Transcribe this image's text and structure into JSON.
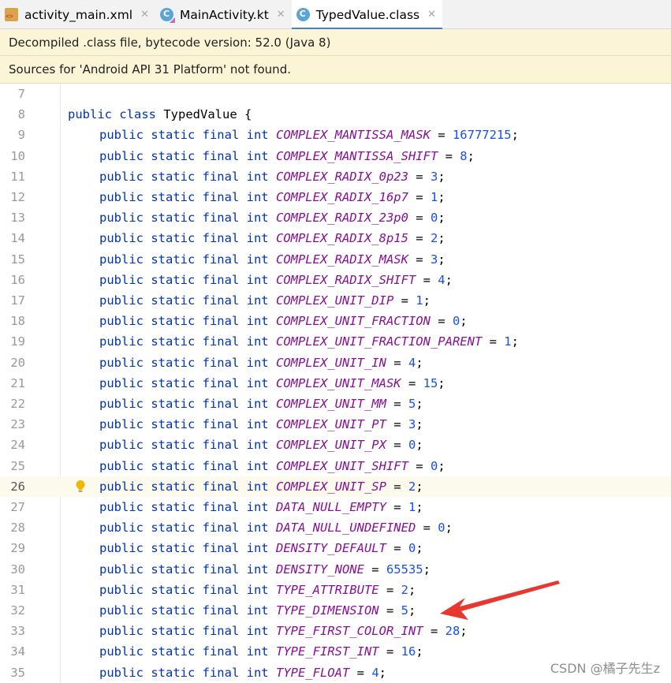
{
  "tabs": [
    {
      "label": "activity_main.xml",
      "icon": "xml-file-icon"
    },
    {
      "label": "MainActivity.kt",
      "icon": "kotlin-file-icon"
    },
    {
      "label": "TypedValue.class",
      "icon": "class-file-icon"
    }
  ],
  "banners": {
    "decompiled": "Decompiled .class file, bytecode version: 52.0 (Java 8)",
    "sources": "Sources for 'Android API 31 Platform' not found."
  },
  "code": {
    "class_line": {
      "num": "8",
      "keyword": "public class",
      "name": "TypedValue {"
    },
    "modifiers": "public static final int",
    "first_line_number": "7",
    "fields": [
      {
        "num": "9",
        "name": "COMPLEX_MANTISSA_MASK",
        "value": "16777215"
      },
      {
        "num": "10",
        "name": "COMPLEX_MANTISSA_SHIFT",
        "value": "8"
      },
      {
        "num": "11",
        "name": "COMPLEX_RADIX_0p23",
        "value": "3"
      },
      {
        "num": "12",
        "name": "COMPLEX_RADIX_16p7",
        "value": "1"
      },
      {
        "num": "13",
        "name": "COMPLEX_RADIX_23p0",
        "value": "0"
      },
      {
        "num": "14",
        "name": "COMPLEX_RADIX_8p15",
        "value": "2"
      },
      {
        "num": "15",
        "name": "COMPLEX_RADIX_MASK",
        "value": "3"
      },
      {
        "num": "16",
        "name": "COMPLEX_RADIX_SHIFT",
        "value": "4"
      },
      {
        "num": "17",
        "name": "COMPLEX_UNIT_DIP",
        "value": "1"
      },
      {
        "num": "18",
        "name": "COMPLEX_UNIT_FRACTION",
        "value": "0"
      },
      {
        "num": "19",
        "name": "COMPLEX_UNIT_FRACTION_PARENT",
        "value": "1"
      },
      {
        "num": "20",
        "name": "COMPLEX_UNIT_IN",
        "value": "4"
      },
      {
        "num": "21",
        "name": "COMPLEX_UNIT_MASK",
        "value": "15"
      },
      {
        "num": "22",
        "name": "COMPLEX_UNIT_MM",
        "value": "5"
      },
      {
        "num": "23",
        "name": "COMPLEX_UNIT_PT",
        "value": "3"
      },
      {
        "num": "24",
        "name": "COMPLEX_UNIT_PX",
        "value": "0"
      },
      {
        "num": "25",
        "name": "COMPLEX_UNIT_SHIFT",
        "value": "0"
      },
      {
        "num": "26",
        "name": "COMPLEX_UNIT_SP",
        "value": "2"
      },
      {
        "num": "27",
        "name": "DATA_NULL_EMPTY",
        "value": "1"
      },
      {
        "num": "28",
        "name": "DATA_NULL_UNDEFINED",
        "value": "0"
      },
      {
        "num": "29",
        "name": "DENSITY_DEFAULT",
        "value": "0"
      },
      {
        "num": "30",
        "name": "DENSITY_NONE",
        "value": "65535"
      },
      {
        "num": "31",
        "name": "TYPE_ATTRIBUTE",
        "value": "2"
      },
      {
        "num": "32",
        "name": "TYPE_DIMENSION",
        "value": "5"
      },
      {
        "num": "33",
        "name": "TYPE_FIRST_COLOR_INT",
        "value": "28"
      },
      {
        "num": "34",
        "name": "TYPE_FIRST_INT",
        "value": "16"
      },
      {
        "num": "35",
        "name": "TYPE_FLOAT",
        "value": "4"
      }
    ],
    "current_line": "26",
    "annotated_line": "32"
  },
  "colors": {
    "keyword": "#0033b3",
    "field": "#871094",
    "number": "#1750eb",
    "arrow": "#e8372f",
    "banner": "#fbf4d6"
  },
  "watermark": "CSDN @橘子先生z"
}
